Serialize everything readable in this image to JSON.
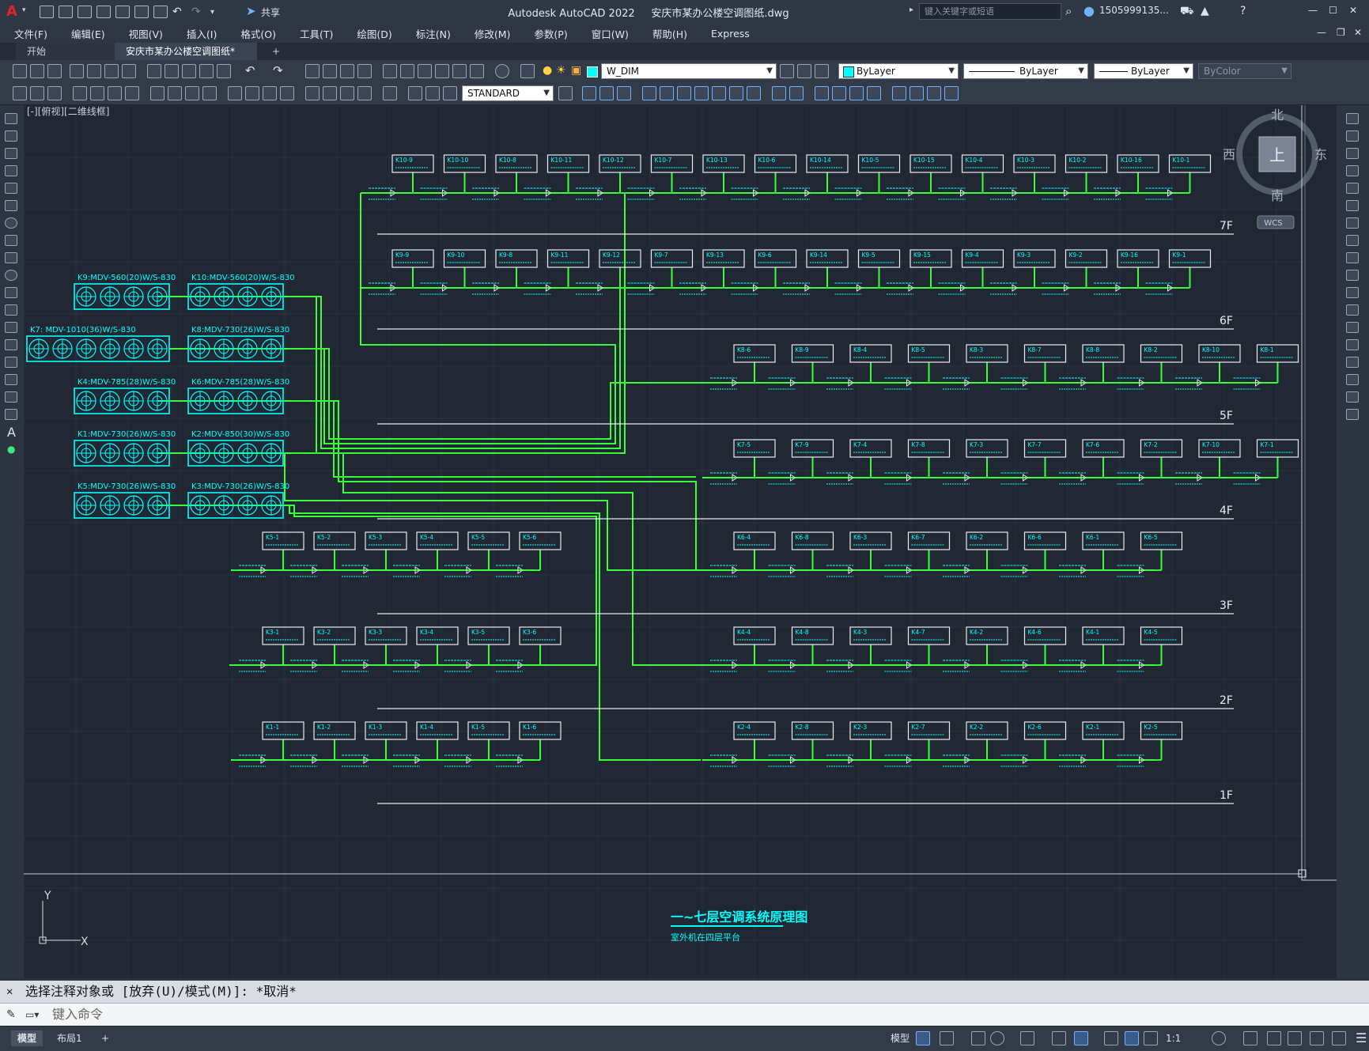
{
  "title_bar": {
    "logo": "A",
    "share_label": "共享",
    "app_name": "Autodesk AutoCAD 2022",
    "file_name": "安庆市某办公楼空调图纸.dwg",
    "search_placeholder": "键入关键字或短语",
    "user": "1505999135...",
    "window_controls": [
      "—",
      "☐",
      "✕"
    ]
  },
  "menu": [
    "文件(F)",
    "编辑(E)",
    "视图(V)",
    "插入(I)",
    "格式(O)",
    "工具(T)",
    "绘图(D)",
    "标注(N)",
    "修改(M)",
    "参数(P)",
    "窗口(W)",
    "帮助(H)",
    "Express"
  ],
  "tabs": {
    "start": "开始",
    "active": "安庆市某办公楼空调图纸*",
    "close": "✕",
    "add": "+"
  },
  "toolbar": {
    "layer": "W_DIM",
    "color": "ByLayer",
    "linetype": "ByLayer",
    "lineweight": "ByLayer",
    "plotstyle": "ByColor",
    "textstyle": "STANDARD"
  },
  "viewport": {
    "label": "[-][俯视][二维线框]"
  },
  "viewcube": {
    "north": "北",
    "south": "南",
    "east": "东",
    "west": "西",
    "top": "上",
    "wcs": "WCS"
  },
  "ucs": {
    "x": "X",
    "y": "Y"
  },
  "drawing": {
    "title": "一~七层空调系统原理图",
    "subtitle": "室外机在四层平台",
    "floors": [
      "7F",
      "6F",
      "5F",
      "4F",
      "3F",
      "2F",
      "1F"
    ],
    "outdoor_units": [
      {
        "label": "K9:MDV-560(20)W/S-830"
      },
      {
        "label": "K10:MDV-560(20)W/S-830"
      },
      {
        "label": "K7: MDV-1010(36)W/S-830"
      },
      {
        "label": "K8:MDV-730(26)W/S-830"
      },
      {
        "label": "K4:MDV-785(28)W/S-830"
      },
      {
        "label": "K6:MDV-785(28)W/S-830"
      },
      {
        "label": "K1:MDV-730(26)W/S-830"
      },
      {
        "label": "K2:MDV-850(30)W/S-830"
      },
      {
        "label": "K5:MDV-730(26)W/S-830"
      },
      {
        "label": "K3:MDV-730(26)W/S-830"
      }
    ],
    "row7": [
      "K10-9",
      "K10-10",
      "K10-8",
      "K10-11",
      "K10-12",
      "K10-7",
      "K10-13",
      "K10-6",
      "K10-14",
      "K10-5",
      "K10-15",
      "K10-4",
      "K10-3",
      "K10-2",
      "K10-16",
      "K10-1"
    ],
    "row6": [
      "K9-9",
      "K9-10",
      "K9-8",
      "K9-11",
      "K9-12",
      "K9-7",
      "K9-13",
      "K9-6",
      "K9-14",
      "K9-5",
      "K9-15",
      "K9-4",
      "K9-3",
      "K9-2",
      "K9-16",
      "K9-1"
    ],
    "row5": [
      "K8-6",
      "K8-9",
      "K8-4",
      "K8-5",
      "K8-3",
      "K8-7",
      "K8-8",
      "K8-2",
      "K8-10",
      "K8-1"
    ],
    "row4": [
      "K7-5",
      "K7-9",
      "K7-4",
      "K7-8",
      "K7-3",
      "K7-7",
      "K7-6",
      "K7-2",
      "K7-10",
      "K7-1"
    ],
    "row3a": [
      "K5-1",
      "K5-2",
      "K5-3",
      "K5-4",
      "K5-5",
      "K5-6"
    ],
    "row3b": [
      "K6-4",
      "K6-8",
      "K6-3",
      "K6-7",
      "K6-2",
      "K6-6",
      "K6-1",
      "K6-5"
    ],
    "row2a": [
      "K3-1",
      "K3-2",
      "K3-3",
      "K3-4",
      "K3-5",
      "K3-6"
    ],
    "row2b": [
      "K4-4",
      "K4-8",
      "K4-3",
      "K4-7",
      "K4-2",
      "K4-6",
      "K4-1",
      "K4-5"
    ],
    "row1a": [
      "K1-1",
      "K1-2",
      "K1-3",
      "K1-4",
      "K1-5",
      "K1-6"
    ],
    "row1b": [
      "K2-4",
      "K2-8",
      "K2-3",
      "K2-7",
      "K2-2",
      "K2-6",
      "K2-1",
      "K2-5"
    ]
  },
  "command": {
    "history": "选择注释对象或 [放弃(U)/模式(M)]: *取消*",
    "placeholder": "键入命令"
  },
  "status": {
    "model_tab": "模型",
    "layout_tab": "布局1",
    "add": "+",
    "model_btn": "模型",
    "scale": "1:1"
  }
}
